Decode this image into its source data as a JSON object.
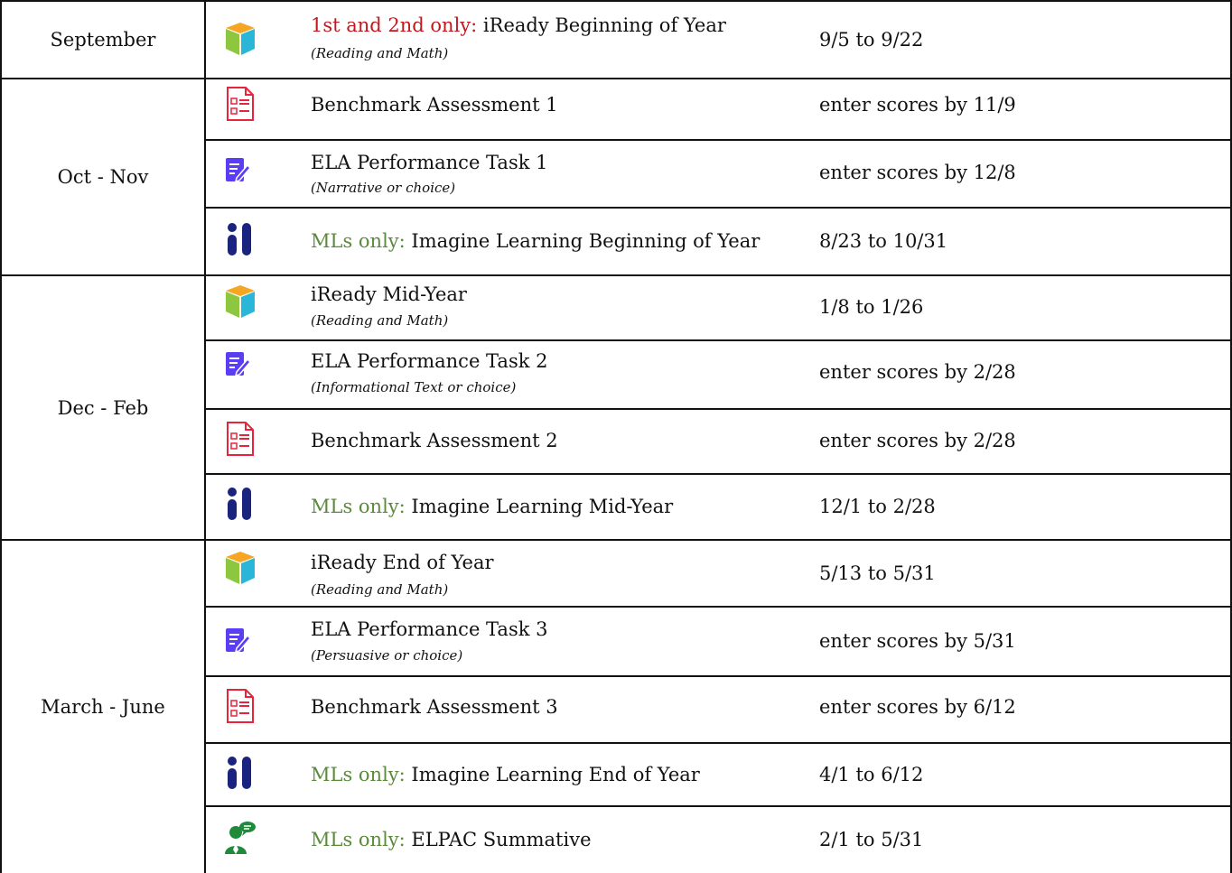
{
  "periods": [
    {
      "label": "September"
    },
    {
      "label": "Oct - Nov"
    },
    {
      "label": "Dec - Feb"
    },
    {
      "label": "March - June"
    }
  ],
  "rows": [
    {
      "icon": "iready-cube-icon",
      "prefix": "1st and 2nd only: ",
      "prefix_color": "#c0191f",
      "title": "iReady Beginning of Year",
      "subtitle": "(Reading and Math)",
      "date": "9/5 to 9/22"
    },
    {
      "icon": "checklist-document-icon",
      "prefix": "",
      "title": "Benchmark Assessment 1",
      "subtitle": "",
      "date": "enter scores by 11/9"
    },
    {
      "icon": "edit-document-icon",
      "prefix": "",
      "title": "ELA Performance Task 1",
      "subtitle": "(Narrative or choice)",
      "date": "enter scores by 12/8"
    },
    {
      "icon": "imagine-learning-icon",
      "prefix": "MLs only: ",
      "prefix_color": "#5a8a3a",
      "title": "Imagine Learning Beginning of Year",
      "subtitle": "",
      "date": "8/23 to 10/31"
    },
    {
      "icon": "iready-cube-icon",
      "prefix": "",
      "title": "iReady Mid-Year",
      "subtitle": "(Reading and Math)",
      "date": "1/8 to 1/26"
    },
    {
      "icon": "edit-document-icon",
      "prefix": "",
      "title": "ELA Performance Task 2",
      "subtitle": "(Informational Text or choice)",
      "date": "enter scores by 2/28"
    },
    {
      "icon": "checklist-document-icon",
      "prefix": "",
      "title": "Benchmark Assessment 2",
      "subtitle": "",
      "date": "enter scores by 2/28"
    },
    {
      "icon": "imagine-learning-icon",
      "prefix": "MLs only: ",
      "prefix_color": "#5a8a3a",
      "title": "Imagine Learning Mid-Year",
      "subtitle": "",
      "date": "12/1 to 2/28"
    },
    {
      "icon": "iready-cube-icon",
      "prefix": "",
      "title": "iReady End of Year",
      "subtitle": "(Reading and Math)",
      "date": "5/13 to 5/31"
    },
    {
      "icon": "edit-document-icon",
      "prefix": "",
      "title": "ELA Performance Task 3",
      "subtitle": "(Persuasive or choice)",
      "date": "enter scores by 5/31"
    },
    {
      "icon": "checklist-document-icon",
      "prefix": "",
      "title": "Benchmark Assessment 3",
      "subtitle": "",
      "date": "enter scores by 6/12"
    },
    {
      "icon": "imagine-learning-icon",
      "prefix": "MLs only: ",
      "prefix_color": "#5a8a3a",
      "title": "Imagine Learning End of Year",
      "subtitle": "",
      "date": "4/1 to 6/12"
    },
    {
      "icon": "speaking-person-icon",
      "prefix": "MLs only: ",
      "prefix_color": "#5a8a3a",
      "title": "ELPAC Summative",
      "subtitle": "",
      "date": "2/1 to 5/31"
    }
  ],
  "colors": {
    "border": "#111111",
    "red_prefix": "#c0191f",
    "green_prefix": "#5a8a3a",
    "iready_orange": "#f5a623",
    "iready_green": "#8dc63f",
    "iready_blue": "#29b6d8",
    "checklist_red": "#e8243c",
    "edit_purple": "#5b3df5",
    "imagine_navy": "#1a237e",
    "speaker_green": "#1e8a3a"
  }
}
